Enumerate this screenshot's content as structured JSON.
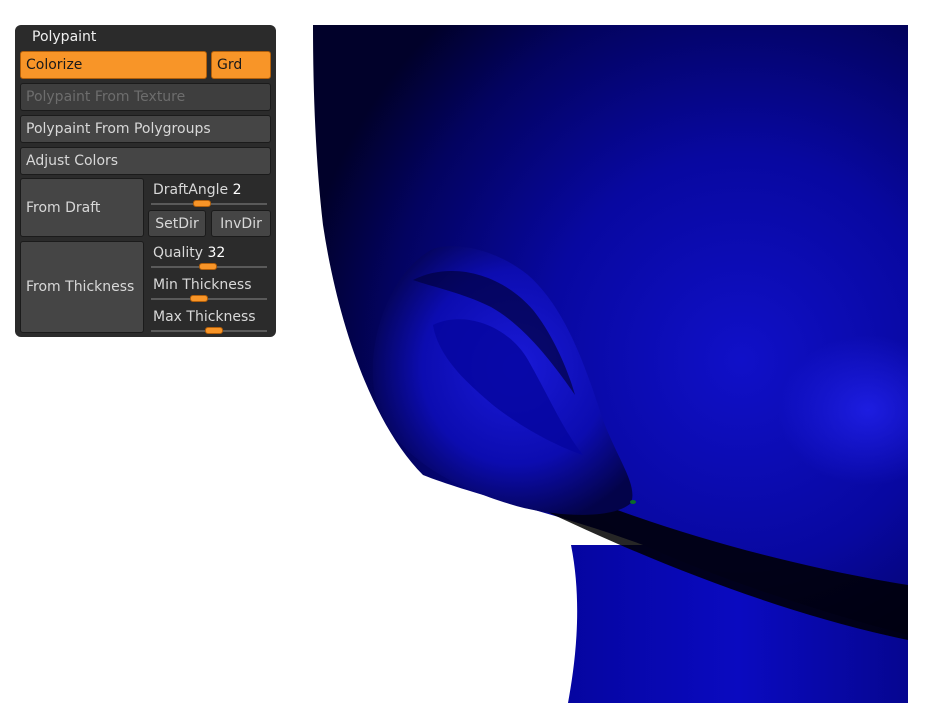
{
  "panel": {
    "title": "Polypaint",
    "colorize_label": "Colorize",
    "grd_label": "Grd",
    "from_texture_label": "Polypaint From Texture",
    "from_polygroups_label": "Polypaint From Polygroups",
    "adjust_colors_label": "Adjust Colors",
    "from_draft_label": "From Draft",
    "draft_angle": {
      "label": "DraftAngle",
      "value": "2"
    },
    "setdir_label": "SetDir",
    "invdir_label": "InvDir",
    "from_thickness_label": "From Thickness",
    "quality": {
      "label": "Quality",
      "value": "32"
    },
    "min_thickness_label": "Min Thickness",
    "max_thickness_label": "Max Thickness"
  },
  "colors": {
    "accent": "#f89528",
    "panel_bg": "#2b2b2b",
    "button_bg": "#454545",
    "model_blue": "#0a0aa8"
  },
  "viewport": {
    "subject": "blue-polypainted-head-ear"
  }
}
